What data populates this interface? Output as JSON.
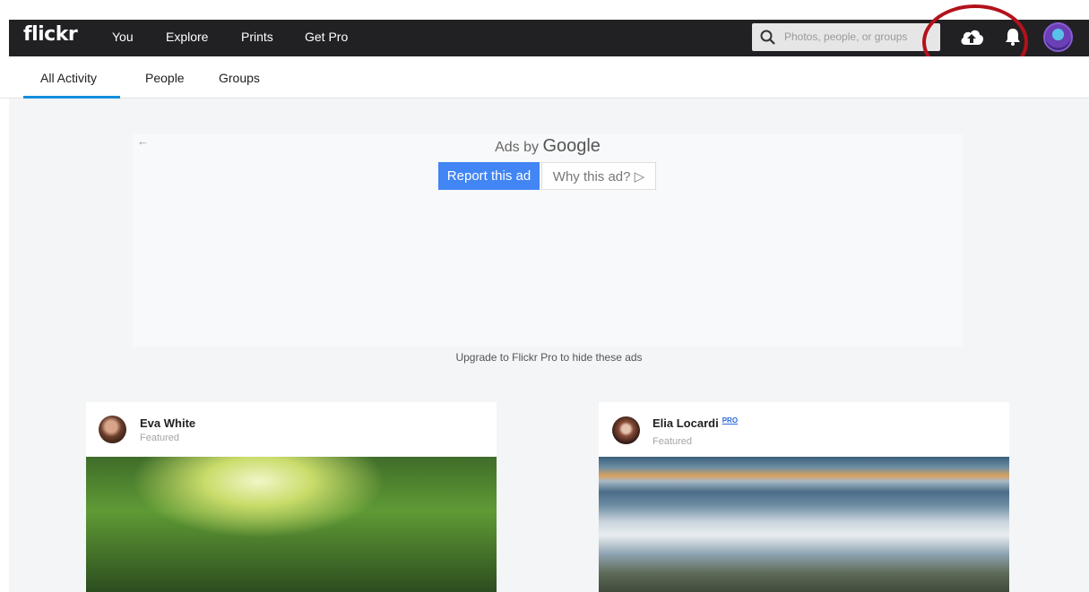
{
  "topbar": {
    "logo": "flickr",
    "nav": [
      "You",
      "Explore",
      "Prints",
      "Get Pro"
    ],
    "search_placeholder": "Photos, people, or groups"
  },
  "tabs": [
    "All Activity",
    "People",
    "Groups"
  ],
  "active_tab": "All Activity",
  "ad": {
    "back_arrow": "←",
    "ads_by": "Ads by",
    "google": "Google",
    "report_label": "Report this ad",
    "why_label": "Why this ad? ▷",
    "upgrade_text": "Upgrade to Flickr Pro to hide these ads"
  },
  "feed": [
    {
      "name": "Eva White",
      "sub": "Featured",
      "pro": ""
    },
    {
      "name": "Elia Locardi",
      "sub": "Featured",
      "pro": "PRO"
    }
  ],
  "colors": {
    "topbar": "#212124",
    "accent_tab": "#128fdc",
    "report_button": "#4285f4",
    "highlight_ring": "#b3121b"
  },
  "icons": [
    "search-icon",
    "upload-cloud-icon",
    "bell-icon",
    "back-arrow-icon"
  ]
}
